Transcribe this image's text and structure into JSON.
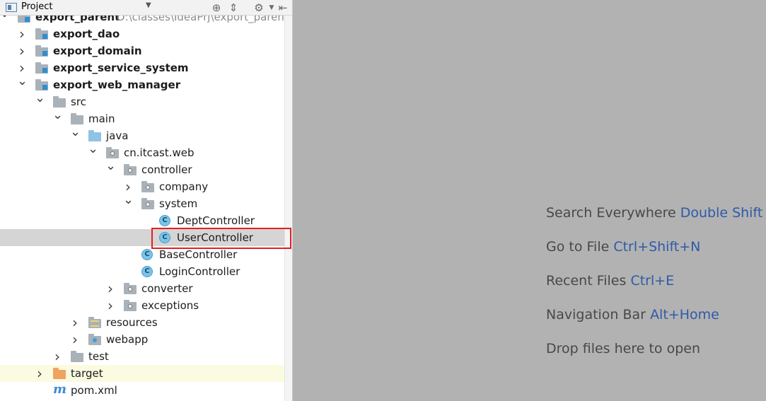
{
  "toolbar": {
    "title": "Project",
    "dropdown_icon": "caret-down",
    "buttons": [
      "locate-icon",
      "collapse-all-icon",
      "settings-icon",
      "hide-icon"
    ]
  },
  "tree": [
    {
      "label": "export_parent",
      "path": "D:\\classes\\IdeaPrj\\export_parent",
      "bold": true,
      "arrow": "expanded",
      "icon": "module-folder"
    },
    {
      "label": "export_dao",
      "bold": true,
      "arrow": "collapsed",
      "icon": "module-folder"
    },
    {
      "label": "export_domain",
      "bold": true,
      "arrow": "collapsed",
      "icon": "module-folder"
    },
    {
      "label": "export_service_system",
      "bold": true,
      "arrow": "collapsed",
      "icon": "module-folder"
    },
    {
      "label": "export_web_manager",
      "bold": true,
      "arrow": "expanded",
      "icon": "module-folder"
    },
    {
      "label": "src",
      "arrow": "expanded",
      "icon": "folder"
    },
    {
      "label": "main",
      "arrow": "expanded",
      "icon": "folder"
    },
    {
      "label": "java",
      "arrow": "expanded",
      "icon": "source-folder"
    },
    {
      "label": "cn.itcast.web",
      "arrow": "expanded",
      "icon": "package"
    },
    {
      "label": "controller",
      "arrow": "expanded",
      "icon": "package"
    },
    {
      "label": "company",
      "arrow": "collapsed",
      "icon": "package"
    },
    {
      "label": "system",
      "arrow": "expanded",
      "icon": "package"
    },
    {
      "label": "DeptController",
      "icon": "class"
    },
    {
      "label": "UserController",
      "icon": "class",
      "selected": true
    },
    {
      "label": "BaseController",
      "icon": "class"
    },
    {
      "label": "LoginController",
      "icon": "class"
    },
    {
      "label": "converter",
      "arrow": "collapsed",
      "icon": "package"
    },
    {
      "label": "exceptions",
      "arrow": "collapsed",
      "icon": "package"
    },
    {
      "label": "resources",
      "arrow": "collapsed",
      "icon": "resources-folder"
    },
    {
      "label": "webapp",
      "arrow": "collapsed",
      "icon": "web-folder"
    },
    {
      "label": "test",
      "arrow": "collapsed",
      "icon": "folder"
    },
    {
      "label": "target",
      "arrow": "collapsed",
      "icon": "excluded-folder",
      "excluded": true
    },
    {
      "label": "pom.xml",
      "icon": "maven-file"
    }
  ],
  "hints": [
    {
      "text": "Search Everywhere",
      "key": "Double Shift"
    },
    {
      "text": "Go to File",
      "key": "Ctrl+Shift+N"
    },
    {
      "text": "Recent Files",
      "key": "Ctrl+E"
    },
    {
      "text": "Navigation Bar",
      "key": "Alt+Home"
    },
    {
      "text": "Drop files here to open",
      "key": ""
    }
  ],
  "colors": {
    "editor_bg": "#b2b2b2",
    "shortcut_key": "#2e5aa8",
    "highlight_border": "#e02020",
    "selected_row": "#d5d5d5"
  }
}
